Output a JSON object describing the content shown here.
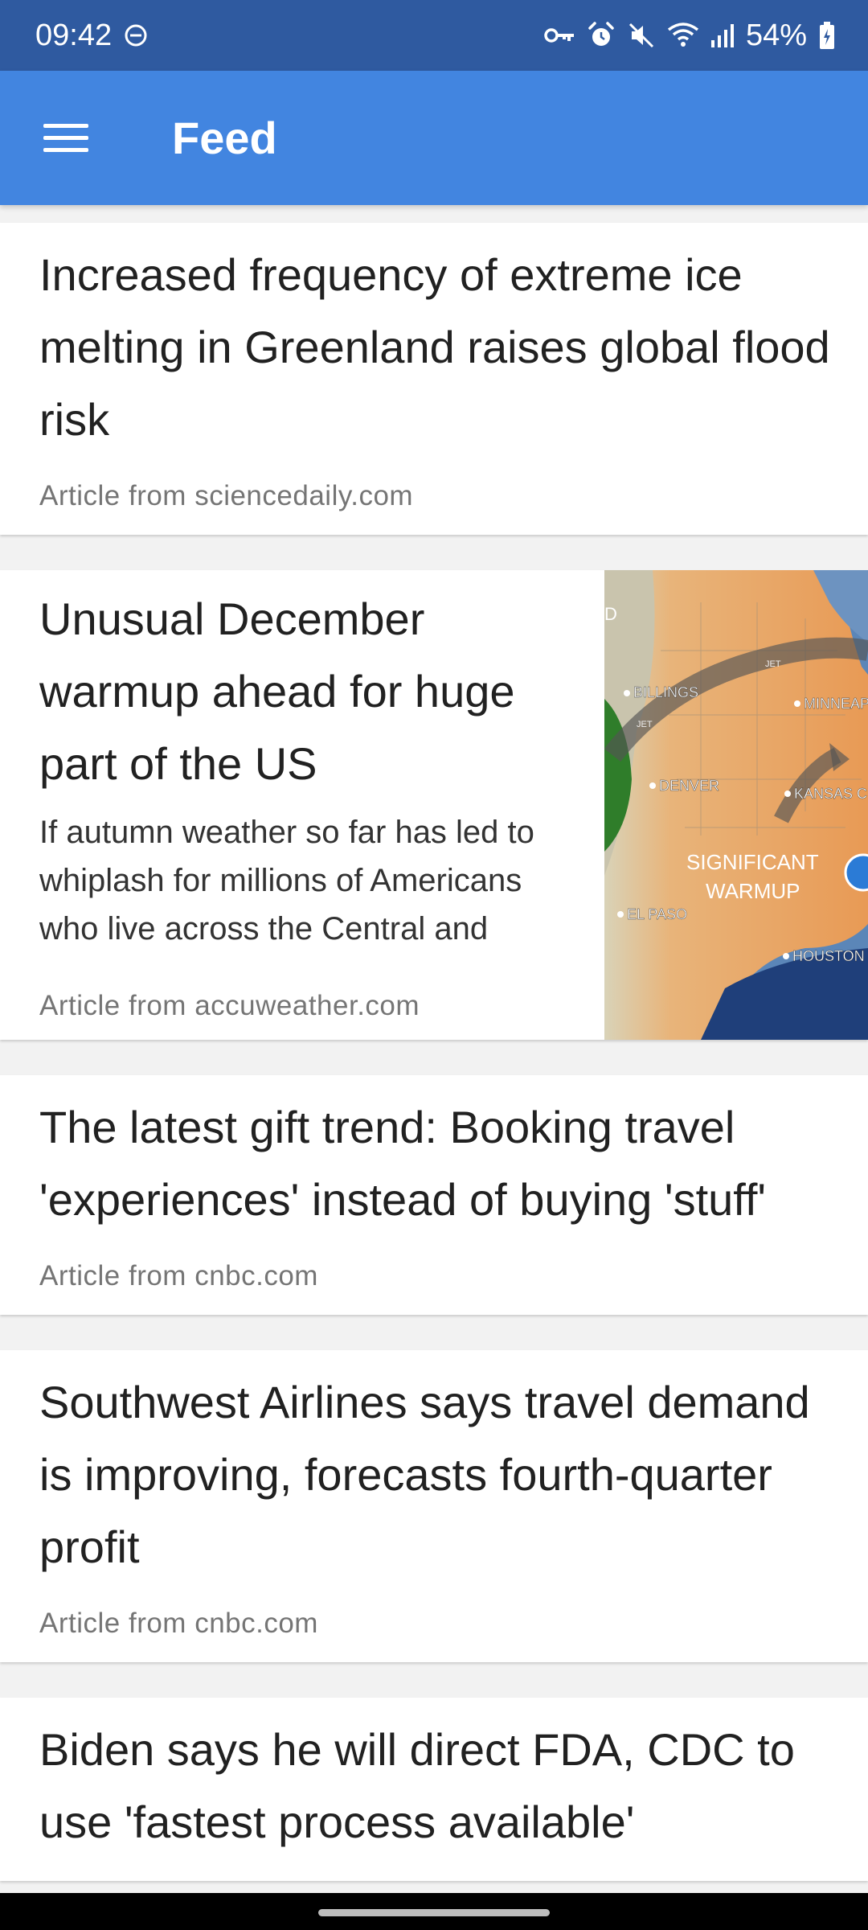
{
  "status_bar": {
    "time": "09:42",
    "battery": "54%",
    "icons": [
      "do-not-disturb-icon",
      "vpn-key-icon",
      "alarm-icon",
      "mute-icon",
      "wifi-icon",
      "signal-icon",
      "battery-charging-icon"
    ]
  },
  "app_bar": {
    "title": "Feed",
    "menu_icon": "hamburger-menu-icon"
  },
  "feed": {
    "items": [
      {
        "headline": "Increased frequency of extreme ice melting in Greenland raises global flood risk",
        "source": "Article from sciencedaily.com"
      },
      {
        "headline": "Unusual December warmup ahead for huge part of the US",
        "summary": "If autumn weather so far has led to whiplash for millions of Americans who live across the Central and Eastern states, it's",
        "source": "Article from accuweather.com",
        "image": {
          "labels": {
            "billings": "BILLINGS",
            "minneapolis": "MINNEAP",
            "denver": "DENVER",
            "kansas": "KANSAS C",
            "el_paso": "EL PASO",
            "houston": "HOUSTON",
            "warmup_line1": "SIGNIFICANT",
            "warmup_line2": "WARMUP",
            "jet1": "JET",
            "jet2": "JET",
            "edge_letter": "D"
          }
        }
      },
      {
        "headline": "The latest gift trend: Booking travel 'experiences' instead of buying 'stuff'",
        "source": "Article from cnbc.com"
      },
      {
        "headline": "Southwest Airlines says travel demand is improving, forecasts fourth-quarter profit",
        "source": "Article from cnbc.com"
      },
      {
        "headline": "Biden says he will direct FDA, CDC to use 'fastest process available'"
      }
    ]
  },
  "colors": {
    "status_bar": "#2f5aa0",
    "app_bar": "#4285e0",
    "background": "#f2f2f2",
    "card": "#ffffff",
    "headline": "#212121",
    "source": "#757575"
  }
}
